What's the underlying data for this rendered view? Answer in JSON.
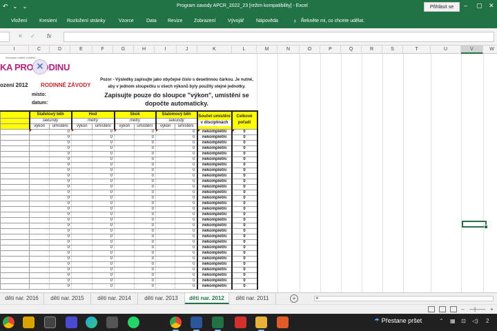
{
  "titlebar": {
    "title": "Program zavody APCR_2022_23  [režim kompatibility]  -  Excel",
    "signin": "Přihlásit se",
    "quick_access": "↶ ⌄ ⌄",
    "minimize": "–",
    "maximize": "▢",
    "close": "✕"
  },
  "ribbon": {
    "tabs": [
      "Vložení",
      "Kreslení",
      "Rozložení stránky",
      "Vzorce",
      "Data",
      "Revize",
      "Zobrazení",
      "Vývojář",
      "Nápověda"
    ],
    "tell_me": "Řekněte mi, co chcete udělat."
  },
  "formula_bar": {
    "cancel": "✕",
    "enter": "✓",
    "fx": "fx",
    "value": ""
  },
  "columns": [
    "I",
    "C",
    "D",
    "E",
    "F",
    "G",
    "H",
    "I",
    "J",
    "K",
    "L",
    "M",
    "N",
    "O",
    "P",
    "Q",
    "R",
    "S",
    "T",
    "U",
    "V",
    "W"
  ],
  "selected_column": "V",
  "header_block": {
    "logo_tagline": "Asociace rodičů a přátel...",
    "logo_text": "KA PRO   RODINU",
    "title_prefix": "ození 2012",
    "title_event": "RODINNÉ ZÁVODY",
    "place_label": "místo:",
    "date_label": "datum:",
    "note": "Pozor - Výsledky zapisujte jako obyčejné číslo s desetinnou čárkou. Je nutné, aby v jednom sloupečku u všech výkonů byly použity stejné jednotky.",
    "instruction": "Zapisujte pouze do sloupce \"výkon\", umístění se dopočte automaticky."
  },
  "table": {
    "groups": [
      {
        "name": "Štafetový běh",
        "unit": "sekundy"
      },
      {
        "name": "Hod",
        "unit": "metry"
      },
      {
        "name": "Skok",
        "unit": "metry"
      },
      {
        "name": "Slalomový běh",
        "unit": "sekundy"
      }
    ],
    "sub_vykon": "výkon",
    "sub_umisteni": "umístění",
    "sum_header": "Součet umístění",
    "sum_sub": "v disciplínách",
    "overall_header": "Celkové pořadí",
    "placement_value": "0",
    "status_value": "nekompletní",
    "overall_value": "0",
    "row_count": 29
  },
  "sheet_tabs": [
    "děti nar. 2016",
    "děti nar. 2015",
    "děti nar. 2014",
    "děti nar. 2013",
    "děti nar. 2012",
    "děti nar. 2011"
  ],
  "active_sheet": "děti nar. 2012",
  "add_sheet": "+",
  "status_bar": {
    "zoom_minus": "–",
    "zoom_plus": "+"
  },
  "taskbar": {
    "weather": "Přestane pršet",
    "tray_time": "2"
  },
  "colors": {
    "excel_green": "#217346",
    "yellow": "#ffff00",
    "title_red": "#c0282d",
    "logo_magenta": "#b22080"
  }
}
